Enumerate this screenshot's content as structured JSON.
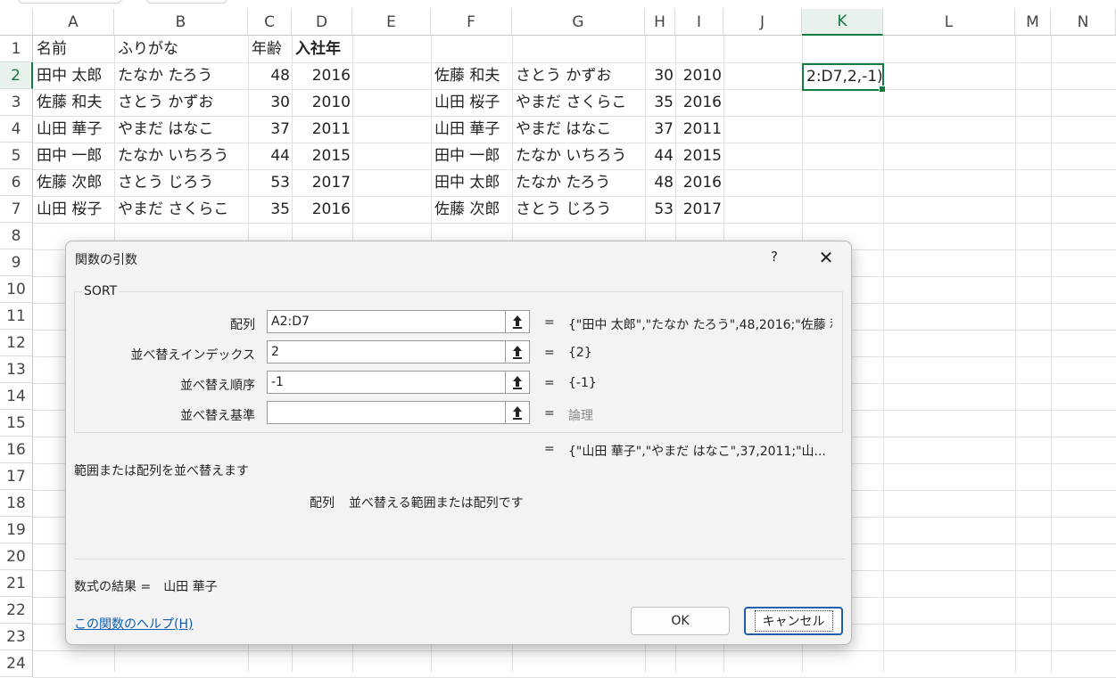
{
  "columns": [
    "A",
    "B",
    "C",
    "D",
    "E",
    "F",
    "G",
    "H",
    "I",
    "J",
    "K",
    "L",
    "M",
    "N"
  ],
  "rows": [
    "1",
    "2",
    "3",
    "4",
    "5",
    "6",
    "7",
    "8",
    "9",
    "10",
    "11",
    "12",
    "13",
    "14",
    "15",
    "16",
    "17",
    "18",
    "19",
    "20",
    "21",
    "22",
    "23",
    "24"
  ],
  "header_row": {
    "a": "名前",
    "b": "ふりがな",
    "c": "年齢",
    "d": "入社年"
  },
  "left_table": [
    {
      "name": "田中 太郎",
      "kana": "たなか たろう",
      "age": "48",
      "year": "2016"
    },
    {
      "name": "佐藤 和夫",
      "kana": "さとう かずお",
      "age": "30",
      "year": "2010"
    },
    {
      "name": "山田 華子",
      "kana": "やまだ はなこ",
      "age": "37",
      "year": "2011"
    },
    {
      "name": "田中 一郎",
      "kana": "たなか いちろう",
      "age": "44",
      "year": "2015"
    },
    {
      "name": "佐藤 次郎",
      "kana": "さとう じろう",
      "age": "53",
      "year": "2017"
    },
    {
      "name": "山田 桜子",
      "kana": "やまだ さくらこ",
      "age": "35",
      "year": "2016"
    }
  ],
  "right_table": [
    {
      "name": "佐藤 和夫",
      "kana": "さとう かずお",
      "age": "30",
      "year": "2010"
    },
    {
      "name": "山田 桜子",
      "kana": "やまだ さくらこ",
      "age": "35",
      "year": "2016"
    },
    {
      "name": "山田 華子",
      "kana": "やまだ はなこ",
      "age": "37",
      "year": "2011"
    },
    {
      "name": "田中 一郎",
      "kana": "たなか いちろう",
      "age": "44",
      "year": "2015"
    },
    {
      "name": "田中 太郎",
      "kana": "たなか たろう",
      "age": "48",
      "year": "2016"
    },
    {
      "name": "佐藤 次郎",
      "kana": "さとう じろう",
      "age": "53",
      "year": "2017"
    }
  ],
  "active_cell": {
    "column": "K",
    "row": "2",
    "text": "2:D7,2,-1)"
  },
  "dialog": {
    "title": "関数の引数",
    "help_symbol": "?",
    "close_symbol": "✕",
    "function_name": "SORT",
    "args": [
      {
        "label": "配列",
        "value": "A2:D7",
        "result": "{\"田中 太郎\",\"たなか たろう\",48,2016;\"佐藤 和"
      },
      {
        "label": "並べ替えインデックス",
        "value": "2",
        "result": "{2}"
      },
      {
        "label": "並べ替え順序",
        "value": "-1",
        "result": "{-1}"
      },
      {
        "label": "並べ替え基準",
        "value": "",
        "result": "論理"
      }
    ],
    "equals": "=",
    "overall_result": "{\"山田 華子\",\"やまだ はなこ\",37,2011;\"山...",
    "description": "範囲または配列を並べ替えます",
    "arg_desc_name": "配列",
    "arg_desc_text": "並べ替える範囲または配列です",
    "formula_result_label": "数式の結果 =",
    "formula_result_value": "山田 華子",
    "help_link": "この関数のヘルプ(H)",
    "ok_label": "OK",
    "cancel_label": "キャンセル"
  }
}
